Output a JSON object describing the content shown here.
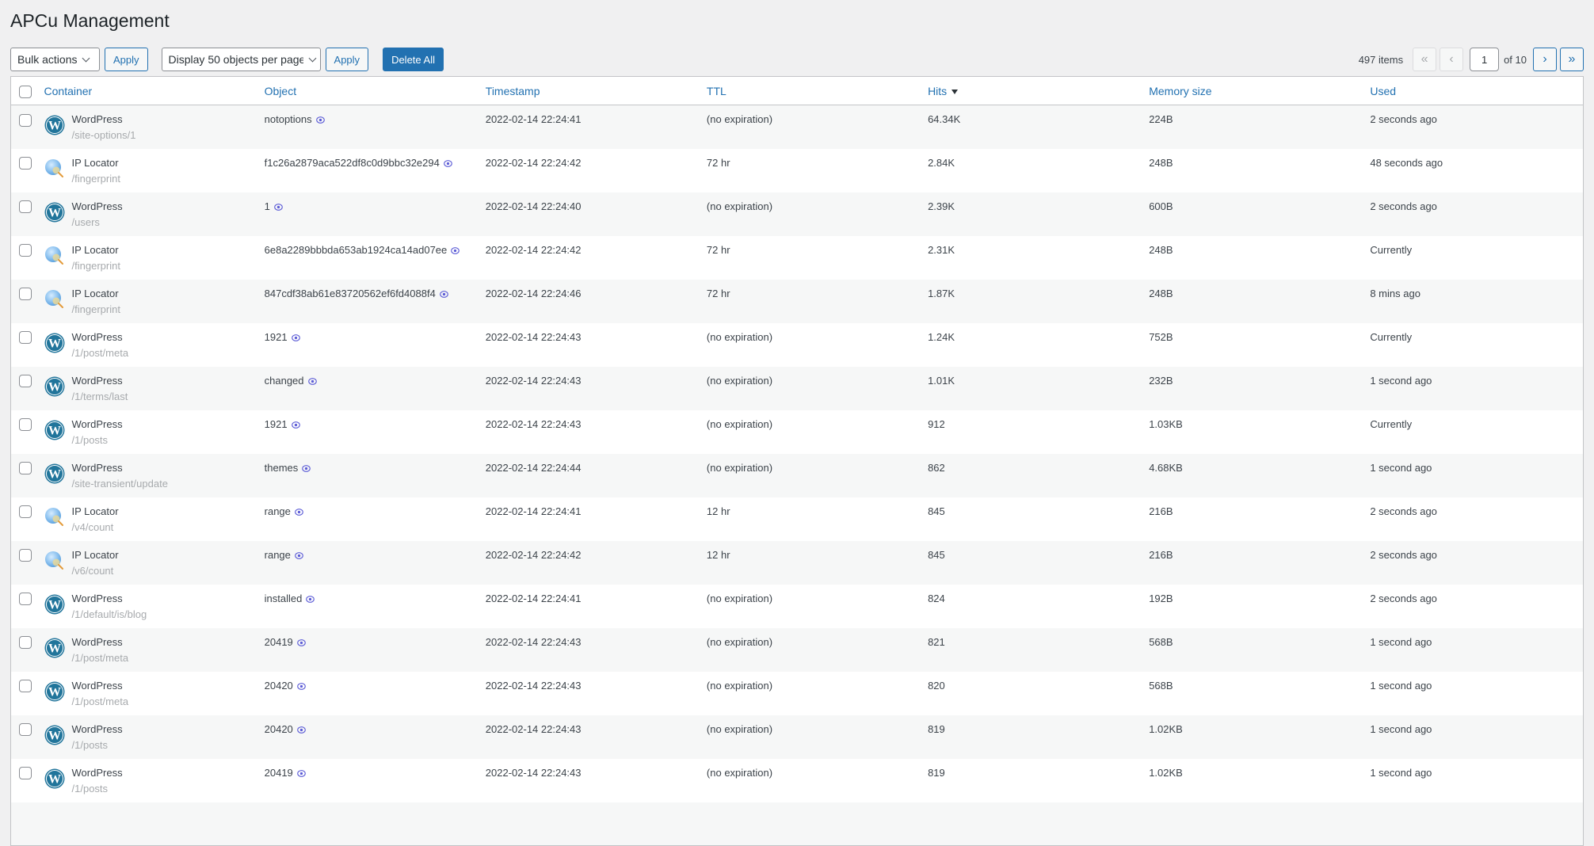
{
  "page": {
    "title": "APCu Management"
  },
  "toolbar": {
    "bulk_actions_label": "Bulk actions",
    "apply_label": "Apply",
    "per_page_label": "Display 50 objects per page",
    "apply2_label": "Apply",
    "delete_all_label": "Delete All"
  },
  "pagination": {
    "items_count": "497 items",
    "first_label": "«",
    "prev_label": "‹",
    "current_page": "1",
    "of_label": "of 10",
    "next_label": "›",
    "last_label": "»"
  },
  "colors": {
    "accent": "#2271b1",
    "wordpress_blue": "#21759b",
    "eye_icon": "#5b5bd6"
  },
  "table": {
    "columns": [
      {
        "key": "container",
        "label": "Container"
      },
      {
        "key": "object",
        "label": "Object"
      },
      {
        "key": "timestamp",
        "label": "Timestamp"
      },
      {
        "key": "ttl",
        "label": "TTL"
      },
      {
        "key": "hits",
        "label": "Hits",
        "sorted": "desc"
      },
      {
        "key": "memory",
        "label": "Memory size"
      },
      {
        "key": "used",
        "label": "Used"
      }
    ],
    "rows": [
      {
        "icon": "wordpress-icon",
        "container": "WordPress",
        "path": "/site-options/1",
        "object": "notoptions",
        "timestamp": "2022-02-14 22:24:41",
        "ttl": "(no expiration)",
        "hits": "64.34K",
        "memory": "224B",
        "used": "2 seconds ago"
      },
      {
        "icon": "ip-locator-icon",
        "container": "IP Locator",
        "path": "/fingerprint",
        "object": "f1c26a2879aca522df8c0d9bbc32e294",
        "timestamp": "2022-02-14 22:24:42",
        "ttl": "72 hr",
        "hits": "2.84K",
        "memory": "248B",
        "used": "48 seconds ago"
      },
      {
        "icon": "wordpress-icon",
        "container": "WordPress",
        "path": "/users",
        "object": "1",
        "timestamp": "2022-02-14 22:24:40",
        "ttl": "(no expiration)",
        "hits": "2.39K",
        "memory": "600B",
        "used": "2 seconds ago"
      },
      {
        "icon": "ip-locator-icon",
        "container": "IP Locator",
        "path": "/fingerprint",
        "object": "6e8a2289bbbda653ab1924ca14ad07ee",
        "timestamp": "2022-02-14 22:24:42",
        "ttl": "72 hr",
        "hits": "2.31K",
        "memory": "248B",
        "used": "Currently"
      },
      {
        "icon": "ip-locator-icon",
        "container": "IP Locator",
        "path": "/fingerprint",
        "object": "847cdf38ab61e83720562ef6fd4088f4",
        "timestamp": "2022-02-14 22:24:46",
        "ttl": "72 hr",
        "hits": "1.87K",
        "memory": "248B",
        "used": "8 mins ago"
      },
      {
        "icon": "wordpress-icon",
        "container": "WordPress",
        "path": "/1/post/meta",
        "object": "1921",
        "timestamp": "2022-02-14 22:24:43",
        "ttl": "(no expiration)",
        "hits": "1.24K",
        "memory": "752B",
        "used": "Currently"
      },
      {
        "icon": "wordpress-icon",
        "container": "WordPress",
        "path": "/1/terms/last",
        "object": "changed",
        "timestamp": "2022-02-14 22:24:43",
        "ttl": "(no expiration)",
        "hits": "1.01K",
        "memory": "232B",
        "used": "1 second ago"
      },
      {
        "icon": "wordpress-icon",
        "container": "WordPress",
        "path": "/1/posts",
        "object": "1921",
        "timestamp": "2022-02-14 22:24:43",
        "ttl": "(no expiration)",
        "hits": "912",
        "memory": "1.03KB",
        "used": "Currently"
      },
      {
        "icon": "wordpress-icon",
        "container": "WordPress",
        "path": "/site-transient/update",
        "object": "themes",
        "timestamp": "2022-02-14 22:24:44",
        "ttl": "(no expiration)",
        "hits": "862",
        "memory": "4.68KB",
        "used": "1 second ago"
      },
      {
        "icon": "ip-locator-icon",
        "container": "IP Locator",
        "path": "/v4/count",
        "object": "range",
        "timestamp": "2022-02-14 22:24:41",
        "ttl": "12 hr",
        "hits": "845",
        "memory": "216B",
        "used": "2 seconds ago"
      },
      {
        "icon": "ip-locator-icon",
        "container": "IP Locator",
        "path": "/v6/count",
        "object": "range",
        "timestamp": "2022-02-14 22:24:42",
        "ttl": "12 hr",
        "hits": "845",
        "memory": "216B",
        "used": "2 seconds ago"
      },
      {
        "icon": "wordpress-icon",
        "container": "WordPress",
        "path": "/1/default/is/blog",
        "object": "installed",
        "timestamp": "2022-02-14 22:24:41",
        "ttl": "(no expiration)",
        "hits": "824",
        "memory": "192B",
        "used": "2 seconds ago"
      },
      {
        "icon": "wordpress-icon",
        "container": "WordPress",
        "path": "/1/post/meta",
        "object": "20419",
        "timestamp": "2022-02-14 22:24:43",
        "ttl": "(no expiration)",
        "hits": "821",
        "memory": "568B",
        "used": "1 second ago"
      },
      {
        "icon": "wordpress-icon",
        "container": "WordPress",
        "path": "/1/post/meta",
        "object": "20420",
        "timestamp": "2022-02-14 22:24:43",
        "ttl": "(no expiration)",
        "hits": "820",
        "memory": "568B",
        "used": "1 second ago"
      },
      {
        "icon": "wordpress-icon",
        "container": "WordPress",
        "path": "/1/posts",
        "object": "20420",
        "timestamp": "2022-02-14 22:24:43",
        "ttl": "(no expiration)",
        "hits": "819",
        "memory": "1.02KB",
        "used": "1 second ago"
      },
      {
        "icon": "wordpress-icon",
        "container": "WordPress",
        "path": "/1/posts",
        "object": "20419",
        "timestamp": "2022-02-14 22:24:43",
        "ttl": "(no expiration)",
        "hits": "819",
        "memory": "1.02KB",
        "used": "1 second ago"
      },
      {
        "icon": "",
        "container": "",
        "path": "",
        "object": "",
        "timestamp": "",
        "ttl": "",
        "hits": "",
        "memory": "",
        "used": ""
      }
    ]
  }
}
